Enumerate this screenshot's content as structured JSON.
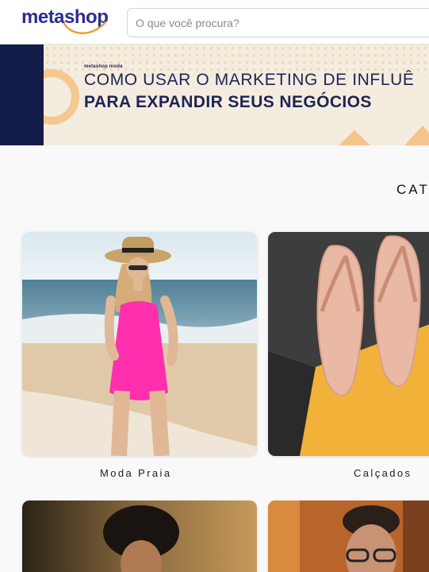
{
  "header": {
    "logo_text": "metashop",
    "search": {
      "placeholder": "O que você procura?"
    }
  },
  "banner": {
    "brand_small": "metashop moda",
    "line1": "COMO USAR O MARKETING DE INFLUÊ",
    "line2": "PARA EXPANDIR SEUS NEGÓCIOS"
  },
  "categories": {
    "heading": "CAT",
    "items": [
      {
        "label": "Moda Praia"
      },
      {
        "label": "Calçados"
      }
    ]
  },
  "colors": {
    "brand": "#2b2f8f",
    "accent": "#f39a2b",
    "navy": "#141c4a",
    "banner_bg": "#f4ecdf"
  }
}
